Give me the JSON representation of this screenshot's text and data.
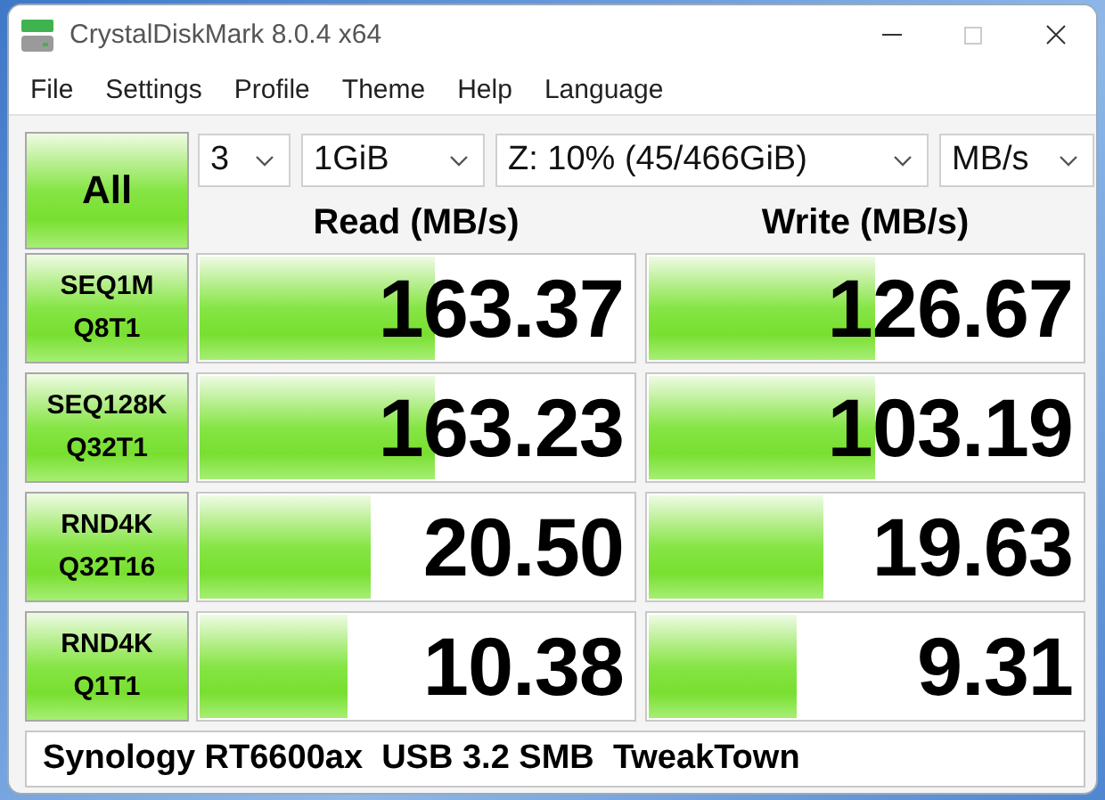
{
  "window": {
    "title": "CrystalDiskMark 8.0.4 x64"
  },
  "menu": [
    "File",
    "Settings",
    "Profile",
    "Theme",
    "Help",
    "Language"
  ],
  "all_button": {
    "label": "All"
  },
  "selects": [
    {
      "value": "3"
    },
    {
      "value": "1GiB"
    },
    {
      "value": "Z: 10% (45/466GiB)"
    },
    {
      "value": "MB/s"
    }
  ],
  "headers": {
    "read": "Read (MB/s)",
    "write": "Write (MB/s)"
  },
  "rows": [
    {
      "test": "SEQ1M",
      "params": "Q8T1",
      "read": {
        "value": "163.37",
        "level": 0.54
      },
      "write": {
        "value": "126.67",
        "level": 0.52
      }
    },
    {
      "test": "SEQ128K",
      "params": "Q32T1",
      "read": {
        "value": "163.23",
        "level": 0.54
      },
      "write": {
        "value": "103.19",
        "level": 0.52
      }
    },
    {
      "test": "RND4K",
      "params": "Q32T16",
      "read": {
        "value": "20.50",
        "level": 0.39
      },
      "write": {
        "value": "19.63",
        "level": 0.4
      }
    },
    {
      "test": "RND4K",
      "params": "Q1T1",
      "read": {
        "value": "10.38",
        "level": 0.34
      },
      "write": {
        "value": "9.31",
        "level": 0.34
      }
    }
  ],
  "comment": "Synology RT6600ax  USB 3.2 SMB  TweakTown"
}
